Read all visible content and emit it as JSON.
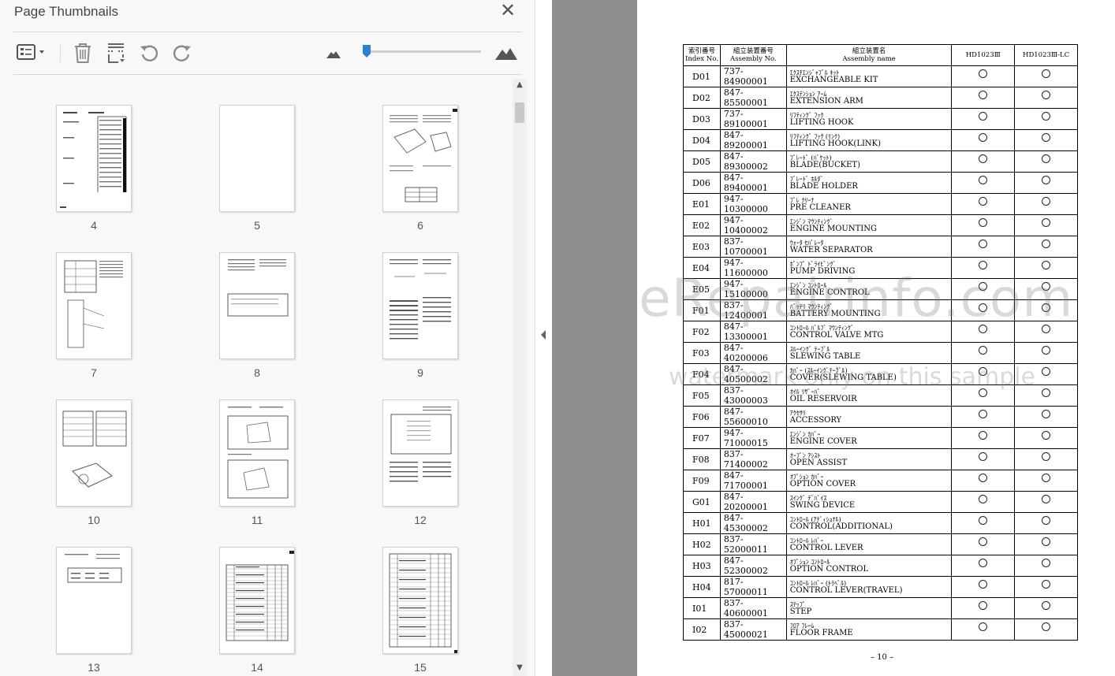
{
  "thumbnail_panel": {
    "title": "Page Thumbnails",
    "close_glyph": "✕",
    "toolbar": {
      "options_icon": "thumbnail-options-icon",
      "delete_icon": "trash-icon",
      "insert_icon": "insert-page-icon",
      "rotate_ccw_icon": "rotate-counterclockwise-icon",
      "rotate_cw_icon": "rotate-clockwise-icon",
      "zoom_out_icon": "small-mountain-icon",
      "zoom_in_icon": "large-mountain-icon",
      "zoom_level": 0.02
    },
    "thumbnails": [
      {
        "page": "4"
      },
      {
        "page": "5"
      },
      {
        "page": "6"
      },
      {
        "page": "7"
      },
      {
        "page": "8"
      },
      {
        "page": "9"
      },
      {
        "page": "10"
      },
      {
        "page": "11"
      },
      {
        "page": "12"
      },
      {
        "page": "13"
      },
      {
        "page": "14"
      },
      {
        "page": "15"
      }
    ]
  },
  "document": {
    "headers": {
      "index_jp": "索引番号",
      "index_en": "Index No.",
      "assembly_no_jp": "組立装置番号",
      "assembly_no_en": "Assembly No.",
      "assembly_name_jp": "組立装置名",
      "assembly_name_en": "Assembly name",
      "model1": "HD1023Ⅲ",
      "model2": "HD1023Ⅲ-LC"
    },
    "rows": [
      {
        "idx": "D01",
        "asm": "737-84900001",
        "jp": "ｴｸｽﾁｴﾝｼﾞｬﾌﾞﾙ ｷｯﾄ",
        "en": "EXCHANGEABLE KIT"
      },
      {
        "idx": "D02",
        "asm": "847-85500001",
        "jp": "ｴｸｽﾃﾝｼｮﾝ ｱｰﾑ",
        "en": "EXTENSION ARM"
      },
      {
        "idx": "D03",
        "asm": "737-89100001",
        "jp": "ﾘﾌﾃｨﾝｸﾞ ﾌｯｸ",
        "en": "LIFTING HOOK"
      },
      {
        "idx": "D04",
        "asm": "847-89200001",
        "jp": "ﾘﾌﾃｨﾝｸﾞ ﾌｯｸ (ﾘﾝｸ)",
        "en": "LIFTING HOOK(LINK)"
      },
      {
        "idx": "D05",
        "asm": "847-89300002",
        "jp": "ﾌﾞﾚｰﾄﾞ (ﾊﾞｹｯﾄ)",
        "en": "BLADE(BUCKET)"
      },
      {
        "idx": "D06",
        "asm": "847-89400001",
        "jp": "ﾌﾞﾚｰﾄﾞ ﾎﾙﾀﾞ",
        "en": "BLADE HOLDER"
      },
      {
        "idx": "E01",
        "asm": "947-10300000",
        "jp": "ﾌﾟﾚ ｸﾘｰﾅ",
        "en": "PRE CLEANER"
      },
      {
        "idx": "E02",
        "asm": "947-10400002",
        "jp": "ｴﾝｼﾞﾝ ﾏｳﾝﾃｨﾝｸﾞ",
        "en": "ENGINE MOUNTING"
      },
      {
        "idx": "E03",
        "asm": "837-10700001",
        "jp": "ｳｫｰﾀ ｾﾊﾟﾚｰﾀ",
        "en": "WATER SEPARATOR"
      },
      {
        "idx": "E04",
        "asm": "947-11600000",
        "jp": "ﾎﾟﾝﾌﾟ ﾄﾞﾗｲﾋﾞﾝｸﾞ",
        "en": "PUMP DRIVING"
      },
      {
        "idx": "E05",
        "asm": "947-15100000",
        "jp": "ｴﾝｼﾞﾝ ｺﾝﾄﾛｰﾙ",
        "en": "ENGINE CONTROL"
      },
      {
        "idx": "F01",
        "asm": "837-12400001",
        "jp": "ﾊﾞｯﾃﾘ ﾏｳﾝﾃｨﾝｸﾞ",
        "en": "BATTERY MOUNTING"
      },
      {
        "idx": "F02",
        "asm": "847-13300001",
        "jp": "ｺﾝﾄﾛｰﾙ ﾊﾞﾙﾌﾞ ﾏｳﾝﾃｨﾝｸﾞ",
        "en": "CONTROL VALVE MTG"
      },
      {
        "idx": "F03",
        "asm": "847-40200006",
        "jp": "ｽﾙｰｲﾝｸﾞ ﾃｰﾌﾞﾙ",
        "en": "SLEWING TABLE"
      },
      {
        "idx": "F04",
        "asm": "847-40500002",
        "jp": "ｶﾊﾞｰ (ｽﾙｰｲﾝｸﾞﾃｰﾌﾞﾙ)",
        "en": "COVER(SLEWING TABLE)"
      },
      {
        "idx": "F05",
        "asm": "837-43000003",
        "jp": "ｵｲﾙ ﾘｻﾞｰﾊﾞ",
        "en": "OIL RESERVOIR"
      },
      {
        "idx": "F06",
        "asm": "847-55600010",
        "jp": "ｱｸｾｻﾘ",
        "en": "ACCESSORY"
      },
      {
        "idx": "F07",
        "asm": "947-71000015",
        "jp": "ｴﾝｼﾞﾝ ｶﾊﾞｰ",
        "en": "ENGINE COVER"
      },
      {
        "idx": "F08",
        "asm": "837-71400002",
        "jp": "ｵｰﾌﾟﾝ ｱｼｽﾄ",
        "en": "OPEN ASSIST"
      },
      {
        "idx": "F09",
        "asm": "847-71700001",
        "jp": "ｵﾌﾟｼｮﾝ ｶﾊﾞｰ",
        "en": "OPTION COVER"
      },
      {
        "idx": "G01",
        "asm": "847-20200001",
        "jp": "ｽｲﾝｸﾞ ﾃﾞﾊﾞｲｽ",
        "en": "SWING DEVICE"
      },
      {
        "idx": "H01",
        "asm": "847-45300002",
        "jp": "ｺﾝﾄﾛｰﾙ (ｱﾃﾞｨｼｮﾅﾙ)",
        "en": "CONTROL(ADDITIONAL)"
      },
      {
        "idx": "H02",
        "asm": "837-52000011",
        "jp": "ｺﾝﾄﾛｰﾙ ﾚﾊﾞｰ",
        "en": "CONTROL LEVER"
      },
      {
        "idx": "H03",
        "asm": "847-52300002",
        "jp": "ｵﾌﾟｼｮﾝ ｺﾝﾄﾛｰﾙ",
        "en": "OPTION CONTROL"
      },
      {
        "idx": "H04",
        "asm": "817-57000011",
        "jp": "ｺﾝﾄﾛｰﾙ ﾚﾊﾞｰ (ﾄﾗﾍﾞﾙ)",
        "en": "CONTROL LEVER(TRAVEL)"
      },
      {
        "idx": "I01",
        "asm": "837-40600001",
        "jp": "ｽﾃｯﾌﾟ",
        "en": "STEP"
      },
      {
        "idx": "I02",
        "asm": "837-45000021",
        "jp": "ﾌﾛｱ ﾌﾚｰﾑ",
        "en": "FLOOR FRAME"
      }
    ],
    "page_footer": "– 10 –",
    "watermark_main": "eRepairinfo.com",
    "watermark_sub": "watermark only on this sample"
  }
}
